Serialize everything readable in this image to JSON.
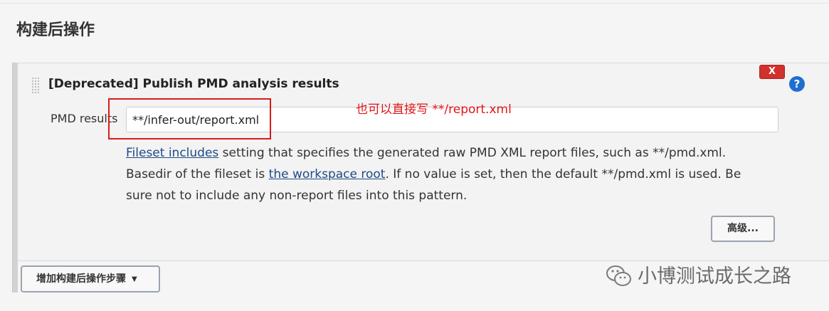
{
  "section": {
    "title": "构建后操作"
  },
  "step": {
    "title": "[Deprecated] Publish PMD analysis results",
    "delete_label": "X",
    "help_label": "?",
    "field": {
      "label": "PMD results",
      "value": "**/infer-out/report.xml"
    },
    "annotation": "也可以直接写 **/report.xml",
    "help": {
      "link1": "Fileset includes",
      "text1": " setting that specifies the generated raw PMD XML report files, such as **/pmd.xml. Basedir of the fileset is ",
      "link2": "the workspace root",
      "text2": ". If no value is set, then the default **/pmd.xml is used. Be sure not to include any non-report files into this pattern."
    },
    "advanced_label": "高级..."
  },
  "add_step": {
    "label": "增加构建后操作步骤"
  },
  "watermark": {
    "text": "小博测试成长之路",
    "icon": "wechat-icon"
  },
  "colors": {
    "annotation": "#e0141a",
    "delete": "#d0312d",
    "help": "#1e6fd0",
    "link": "#204a87"
  }
}
